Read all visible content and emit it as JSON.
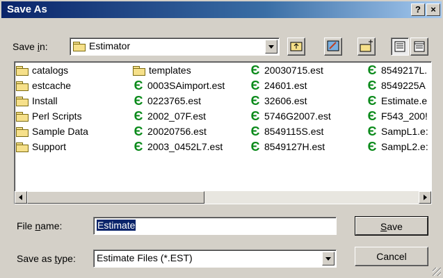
{
  "window": {
    "title": "Save As",
    "help_btn": "?",
    "close_btn": "×"
  },
  "savein": {
    "label_pre": "Save ",
    "label_u": "i",
    "label_post": "n:",
    "value": "Estimator"
  },
  "toolbar": [
    "up-one-level-icon",
    "desktop-icon",
    "new-folder-icon",
    "list-view-icon",
    "details-view-icon"
  ],
  "files": {
    "col1": [
      {
        "name": "catalogs",
        "type": "folder"
      },
      {
        "name": "estcache",
        "type": "folder"
      },
      {
        "name": "Install",
        "type": "folder"
      },
      {
        "name": "Perl Scripts",
        "type": "folder"
      },
      {
        "name": "Sample Data",
        "type": "folder"
      },
      {
        "name": "Support",
        "type": "folder"
      }
    ],
    "col2": [
      {
        "name": "templates",
        "type": "folder"
      },
      {
        "name": "0003SAimport.est",
        "type": "est"
      },
      {
        "name": "0223765.est",
        "type": "est"
      },
      {
        "name": "2002_07F.est",
        "type": "est"
      },
      {
        "name": "20020756.est",
        "type": "est"
      },
      {
        "name": "2003_0452L7.est",
        "type": "est"
      }
    ],
    "col3": [
      {
        "name": "20030715.est",
        "type": "est"
      },
      {
        "name": "24601.est",
        "type": "est"
      },
      {
        "name": "32606.est",
        "type": "est"
      },
      {
        "name": "5746G2007.est",
        "type": "est"
      },
      {
        "name": "8549115S.est",
        "type": "est"
      },
      {
        "name": "8549127H.est",
        "type": "est"
      }
    ],
    "col4": [
      {
        "name": "8549217L.",
        "type": "est"
      },
      {
        "name": "8549225A",
        "type": "est"
      },
      {
        "name": "Estimate.e",
        "type": "est"
      },
      {
        "name": "F543_200!",
        "type": "est"
      },
      {
        "name": "SampL1.e:",
        "type": "est"
      },
      {
        "name": "SampL2.e:",
        "type": "est"
      }
    ]
  },
  "filename": {
    "label_pre": "File ",
    "label_u": "n",
    "label_post": "ame:",
    "value": "Estimate"
  },
  "filetype": {
    "label_pre": "Save as ",
    "label_u": "t",
    "label_post": "ype:",
    "value": "Estimate Files (*.EST)"
  },
  "buttons": {
    "save_u": "S",
    "save_rest": "ave",
    "cancel": "Cancel"
  },
  "colors": {
    "est_icon": "#0a8a1a",
    "folder": "#f6e08a",
    "selection": "#0a246a"
  }
}
